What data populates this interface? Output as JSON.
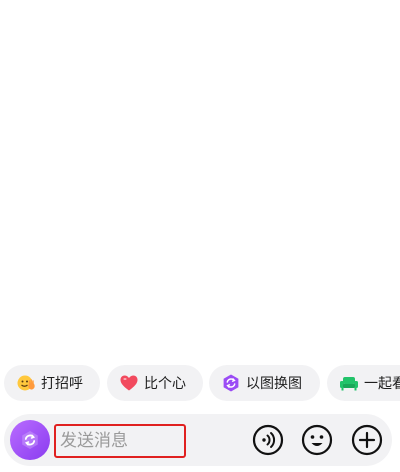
{
  "quick_replies": [
    {
      "label": "打招呼",
      "icon": "wave-emoji-icon"
    },
    {
      "label": "比个心",
      "icon": "heart-icon"
    },
    {
      "label": "以图换图",
      "icon": "image-swap-icon"
    },
    {
      "label": "一起看",
      "icon": "sofa-icon"
    }
  ],
  "input_bar": {
    "placeholder": "发送消息",
    "left_button_icon": "refresh-badge-icon",
    "voice_icon": "voice-icon",
    "emoji_icon": "emoji-icon",
    "plus_icon": "plus-icon"
  },
  "colors": {
    "accent_purple": "#9b4cf5",
    "heart_red": "#f24a5e",
    "sofa_green": "#22c36a",
    "highlight_box": "#e02020",
    "chip_bg": "#f2f2f4"
  }
}
